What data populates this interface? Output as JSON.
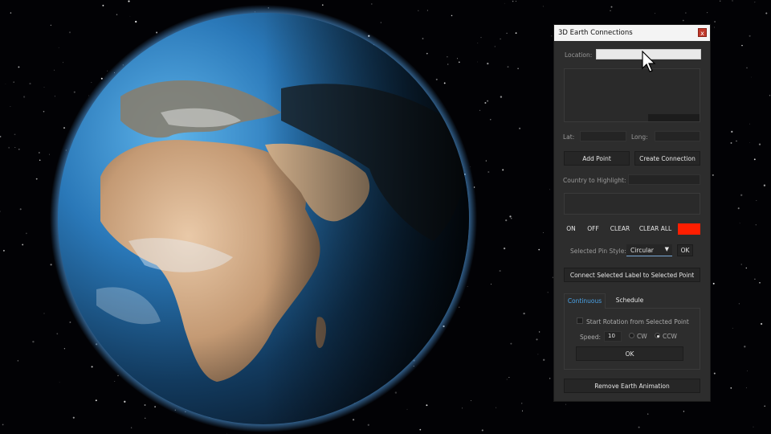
{
  "window": {
    "title": "3D Earth Connections",
    "close_label": "x"
  },
  "location": {
    "label": "Location:",
    "value": ""
  },
  "coords": {
    "lat_label": "Lat:",
    "lat_value": "",
    "long_label": "Long:",
    "long_value": ""
  },
  "buttons": {
    "add_point": "Add Point",
    "create_connection": "Create Connection",
    "on": "ON",
    "off": "OFF",
    "clear": "CLEAR",
    "clear_all": "CLEAR ALL",
    "pin_ok": "OK",
    "connect_label": "Connect Selected Label to Selected Point",
    "rotation_ok": "OK",
    "remove": "Remove Earth Animation"
  },
  "highlight": {
    "label": "Country to Highlight:",
    "value": ""
  },
  "highlight_color": "#ff1e00",
  "pin_style": {
    "label": "Selected Pin Style:",
    "selected": "Circular"
  },
  "tabs": [
    {
      "label": "Continuous",
      "active": true
    },
    {
      "label": "Schedule",
      "active": false
    }
  ],
  "rotation": {
    "checkbox_label": "Start Rotation from Selected Point",
    "checked": false,
    "speed_label": "Speed:",
    "speed_value": "10",
    "cw_label": "CW",
    "ccw_label": "CCW",
    "direction": "CCW"
  },
  "colors": {
    "accent_tab": "#4aa3e8",
    "panel_bg": "#2d2d2d"
  }
}
